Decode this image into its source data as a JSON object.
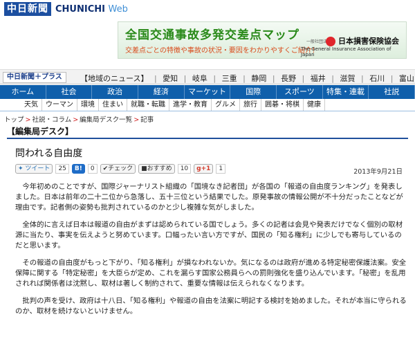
{
  "header": {
    "logo_kanji": "中日新聞",
    "logo_latin": "CHUNICHI",
    "logo_web": "Web"
  },
  "banner": {
    "title": "全国交通事故多発交差点マップ",
    "subtitle": "交差点ごとの特徴や事故の状況・要因をわかりやすくご紹介！",
    "assoc_small": "一般社団法人",
    "assoc_name": "日本損害保険協会",
    "assoc_en": "The General Insurance Association of Japan"
  },
  "regionbar": {
    "logo": "中日新聞＋プラス",
    "items": [
      "【地域のニュース】",
      "愛知",
      "岐阜",
      "三重",
      "静岡",
      "長野",
      "福井",
      "滋賀",
      "石川",
      "富山"
    ]
  },
  "mainnav": [
    "ホーム",
    "社会",
    "政治",
    "経済",
    "マーケット",
    "国際",
    "スポーツ",
    "特集・連載",
    "社説"
  ],
  "subnav": [
    "天気",
    "ウーマン",
    "環境",
    "住まい",
    "就職・転職",
    "進学・教育",
    "グルメ",
    "旅行",
    "囲碁・将棋",
    "健康"
  ],
  "breadcrumb": [
    "トップ",
    "社説・コラム",
    "編集局デスク一覧",
    "記事"
  ],
  "section_title": "【編集局デスク】",
  "article": {
    "title": "問われる自由度",
    "date": "2013年9月21日",
    "paragraphs": [
      "今年初めのことですが、国際ジャーナリスト組織の「国境なき記者団」が各国の「報道の自由度ランキング」を発表しました。日本は前年の二十二位から急落し、五十三位という結果でした。原発事故の情報公開が不十分だったことなどが理由です。記者側の姿勢も批判されているのかと少し複雑な気がしました。",
      "全体的に言えば日本は報道の自由がまずは認められている国でしょう。多くの記者は会見や発表だけでなく個別の取材源に当たり、事実を伝えようと努めています。口幅ったい言い方ですが、国民の「知る権利」に少しでも寄与しているのだと思います。",
      "その報道の自由度がもっと下がり、「知る権利」が損なわれないか。気になるのは政府が進める特定秘密保護法案。安全保障に関する「特定秘密」を大臣らが定め、これを漏らす国家公務員らへの罰則強化を盛り込んでいます。「秘密」を乱用されれば関係者は沈黙し、取材は著しく制約されて、重要な情報は伝えられなくなります。",
      "批判の声を受け、政府は十八日、「知る権利」や報道の自由を法案に明記する検討を始めました。それが本当に守られるのか、取材を続けないといけません。"
    ]
  },
  "social": {
    "tweet_label": "ツイート",
    "tweet_count": "25",
    "hatena_label": "B!",
    "hatena_count": "0",
    "check_label": "チェック",
    "recommend_label": "おすすめ",
    "recommend_count": "10",
    "gplus_label": "g+1",
    "gplus_count": "1"
  }
}
